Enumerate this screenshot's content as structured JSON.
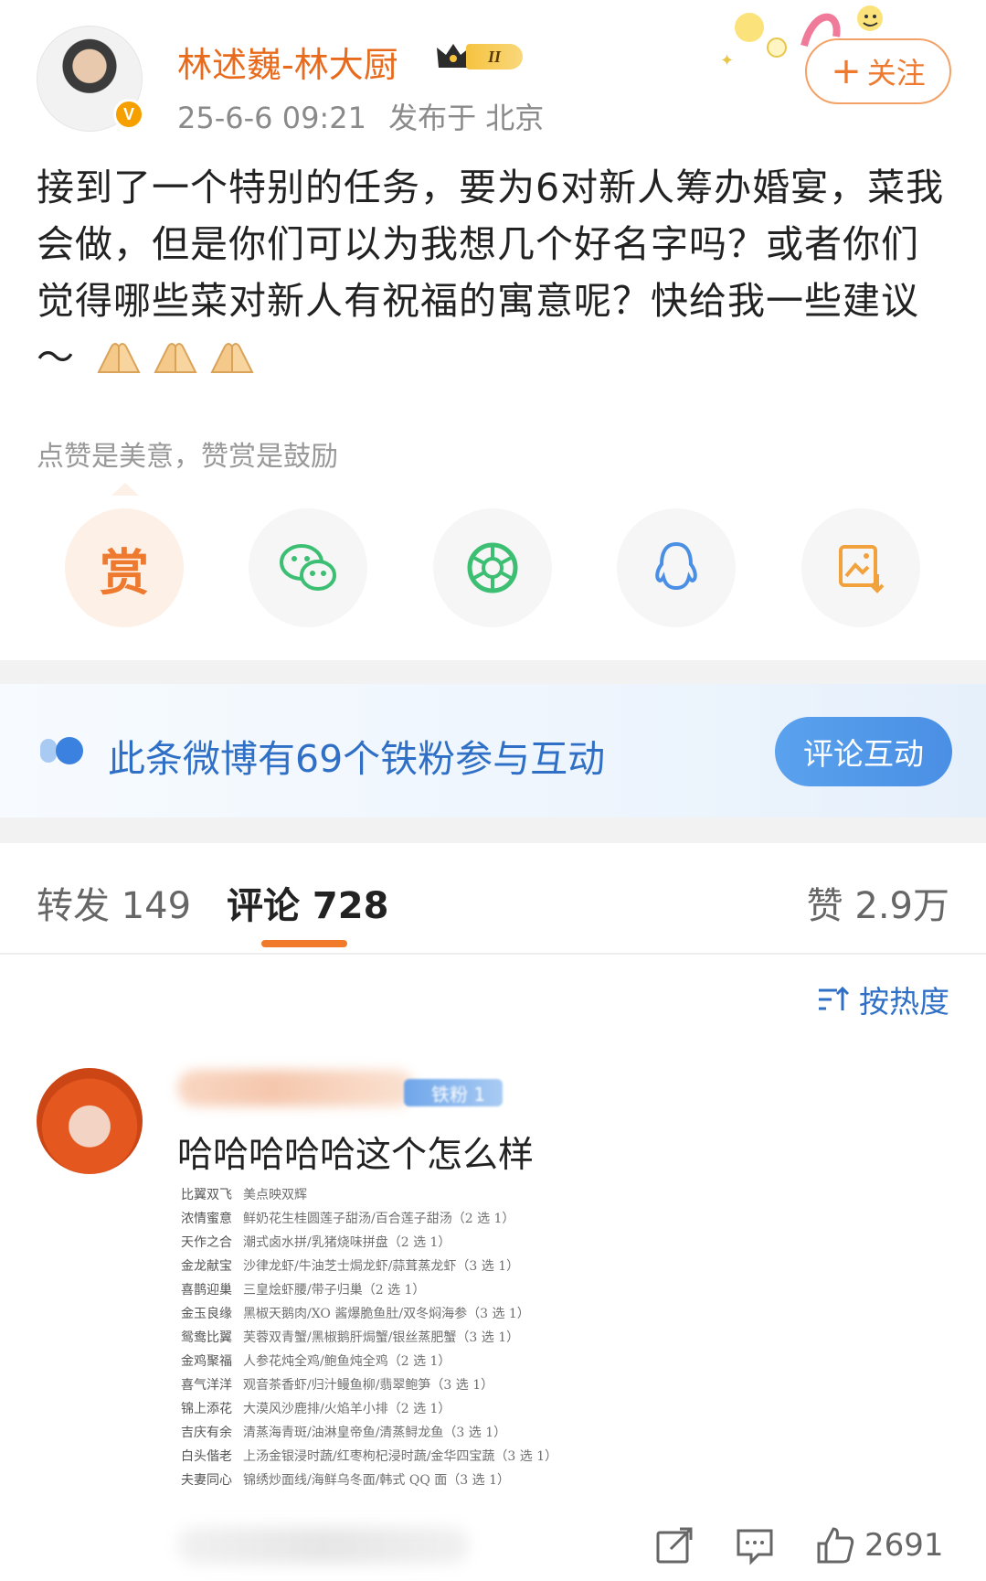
{
  "post": {
    "author": "林述巍-林大厨",
    "level": "II",
    "time": "25-6-6 09:21",
    "published_from": "发布于 北京",
    "follow_label": "关注",
    "follow_plus": "+",
    "text": "接到了一个特别的任务，要为6对新人筹办婚宴，菜我会做，但是你们可以为我想几个好名字吗？或者你们觉得哪些菜对新人有祝福的寓意呢？快给我一些建议～",
    "verified_mark": "V"
  },
  "reward": {
    "hint": "点赞是美意，赞赏是鼓励",
    "button": "赏"
  },
  "share": {
    "items": [
      "reward",
      "wechat",
      "moments",
      "qq",
      "save-image"
    ]
  },
  "fan_banner": {
    "text": "此条微博有69个铁粉参与互动",
    "button": "评论互动"
  },
  "tabs": {
    "repost": "转发 149",
    "comment": "评论 728",
    "like": "赞 2.9万"
  },
  "sort": {
    "label": "按热度"
  },
  "comment": {
    "badge": "铁粉 1",
    "text": "哈哈哈哈哈这个怎么样",
    "like_count": "2691",
    "menu": [
      {
        "name": "比翼双飞",
        "dishes": "美点映双辉"
      },
      {
        "name": "浓情蜜意",
        "dishes": "鲜奶花生桂圆莲子甜汤/百合莲子甜汤（2 选 1）"
      },
      {
        "name": "天作之合",
        "dishes": "潮式卤水拼/乳猪烧味拼盘（2 选 1）"
      },
      {
        "name": "金龙献宝",
        "dishes": "沙律龙虾/牛油芝士焗龙虾/蒜茸蒸龙虾（3 选 1）"
      },
      {
        "name": "喜鹊迎巢",
        "dishes": "三皇烩虾腰/带子归巢（2 选 1）"
      },
      {
        "name": "金玉良缘",
        "dishes": "黑椒天鹅肉/XO 酱爆脆鱼肚/双冬焖海参（3 选 1）"
      },
      {
        "name": "鸳鸯比翼",
        "dishes": "芙蓉双青蟹/黑椒鹅肝焗蟹/银丝蒸肥蟹（3 选 1）"
      },
      {
        "name": "金鸡聚福",
        "dishes": "人参花炖全鸡/鲍鱼炖全鸡（2 选 1）"
      },
      {
        "name": "喜气洋洋",
        "dishes": "观音茶香虾/归汁鳗鱼柳/翡翠鲍笋（3 选 1）"
      },
      {
        "name": "锦上添花",
        "dishes": "大漠风沙鹿排/火焰羊小排（2 选 1）"
      },
      {
        "name": "吉庆有余",
        "dishes": "清蒸海青斑/油淋皇帝鱼/清蒸鲟龙鱼（3 选 1）"
      },
      {
        "name": "白头偕老",
        "dishes": "上汤金银浸时蔬/红枣枸杞浸时蔬/金华四宝蔬（3 选 1）"
      },
      {
        "name": "夫妻同心",
        "dishes": "锦绣炒面线/海鲜乌冬面/韩式 QQ 面（3 选 1）"
      }
    ]
  },
  "colors": {
    "author": "#e86b1d",
    "accent_blue": "#2f70c6",
    "tab_indicator": "#f07a2a"
  },
  "icons": [
    "crown-icon",
    "wechat-icon",
    "moments-icon",
    "qq-icon",
    "save-image-icon",
    "fan-icon",
    "sort-icon",
    "share-icon",
    "comment-icon",
    "like-icon",
    "hands-emoji"
  ]
}
